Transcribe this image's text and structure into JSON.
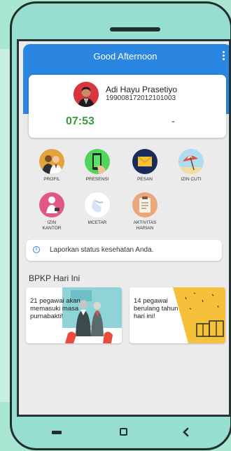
{
  "header": {
    "greeting": "Good Afternoon"
  },
  "profile": {
    "name": "Adi Hayu Prasetiyo",
    "nip": "199008172012101003",
    "time_in": "07:53",
    "time_out": "-"
  },
  "menu": [
    {
      "label": "PROFIL"
    },
    {
      "label": "PRESENSI"
    },
    {
      "label": "PESAN"
    },
    {
      "label": "IZIN CUTI"
    },
    {
      "label": "IZIN KANTOR"
    },
    {
      "label": "MCETAR"
    },
    {
      "label": "AKTIVITAS HARIAN"
    }
  ],
  "notice": {
    "text": "Laporkan status kesehatan Anda."
  },
  "section": {
    "title": "BPKP Hari Ini"
  },
  "banners": [
    {
      "text": "21 pegawai akan memasuki masa purnabakti!"
    },
    {
      "text": "14 pegawai berulang tahun hari ini!"
    }
  ],
  "colors": {
    "accent": "#2b86e2",
    "time_in": "#3a9a3e",
    "birthday_yellow": "#f6c13a"
  },
  "icons": {
    "more": "more-vert-icon",
    "notice": "info-icon",
    "nav_recent": "recent-apps-icon",
    "nav_home": "home-icon",
    "nav_back": "back-icon"
  }
}
